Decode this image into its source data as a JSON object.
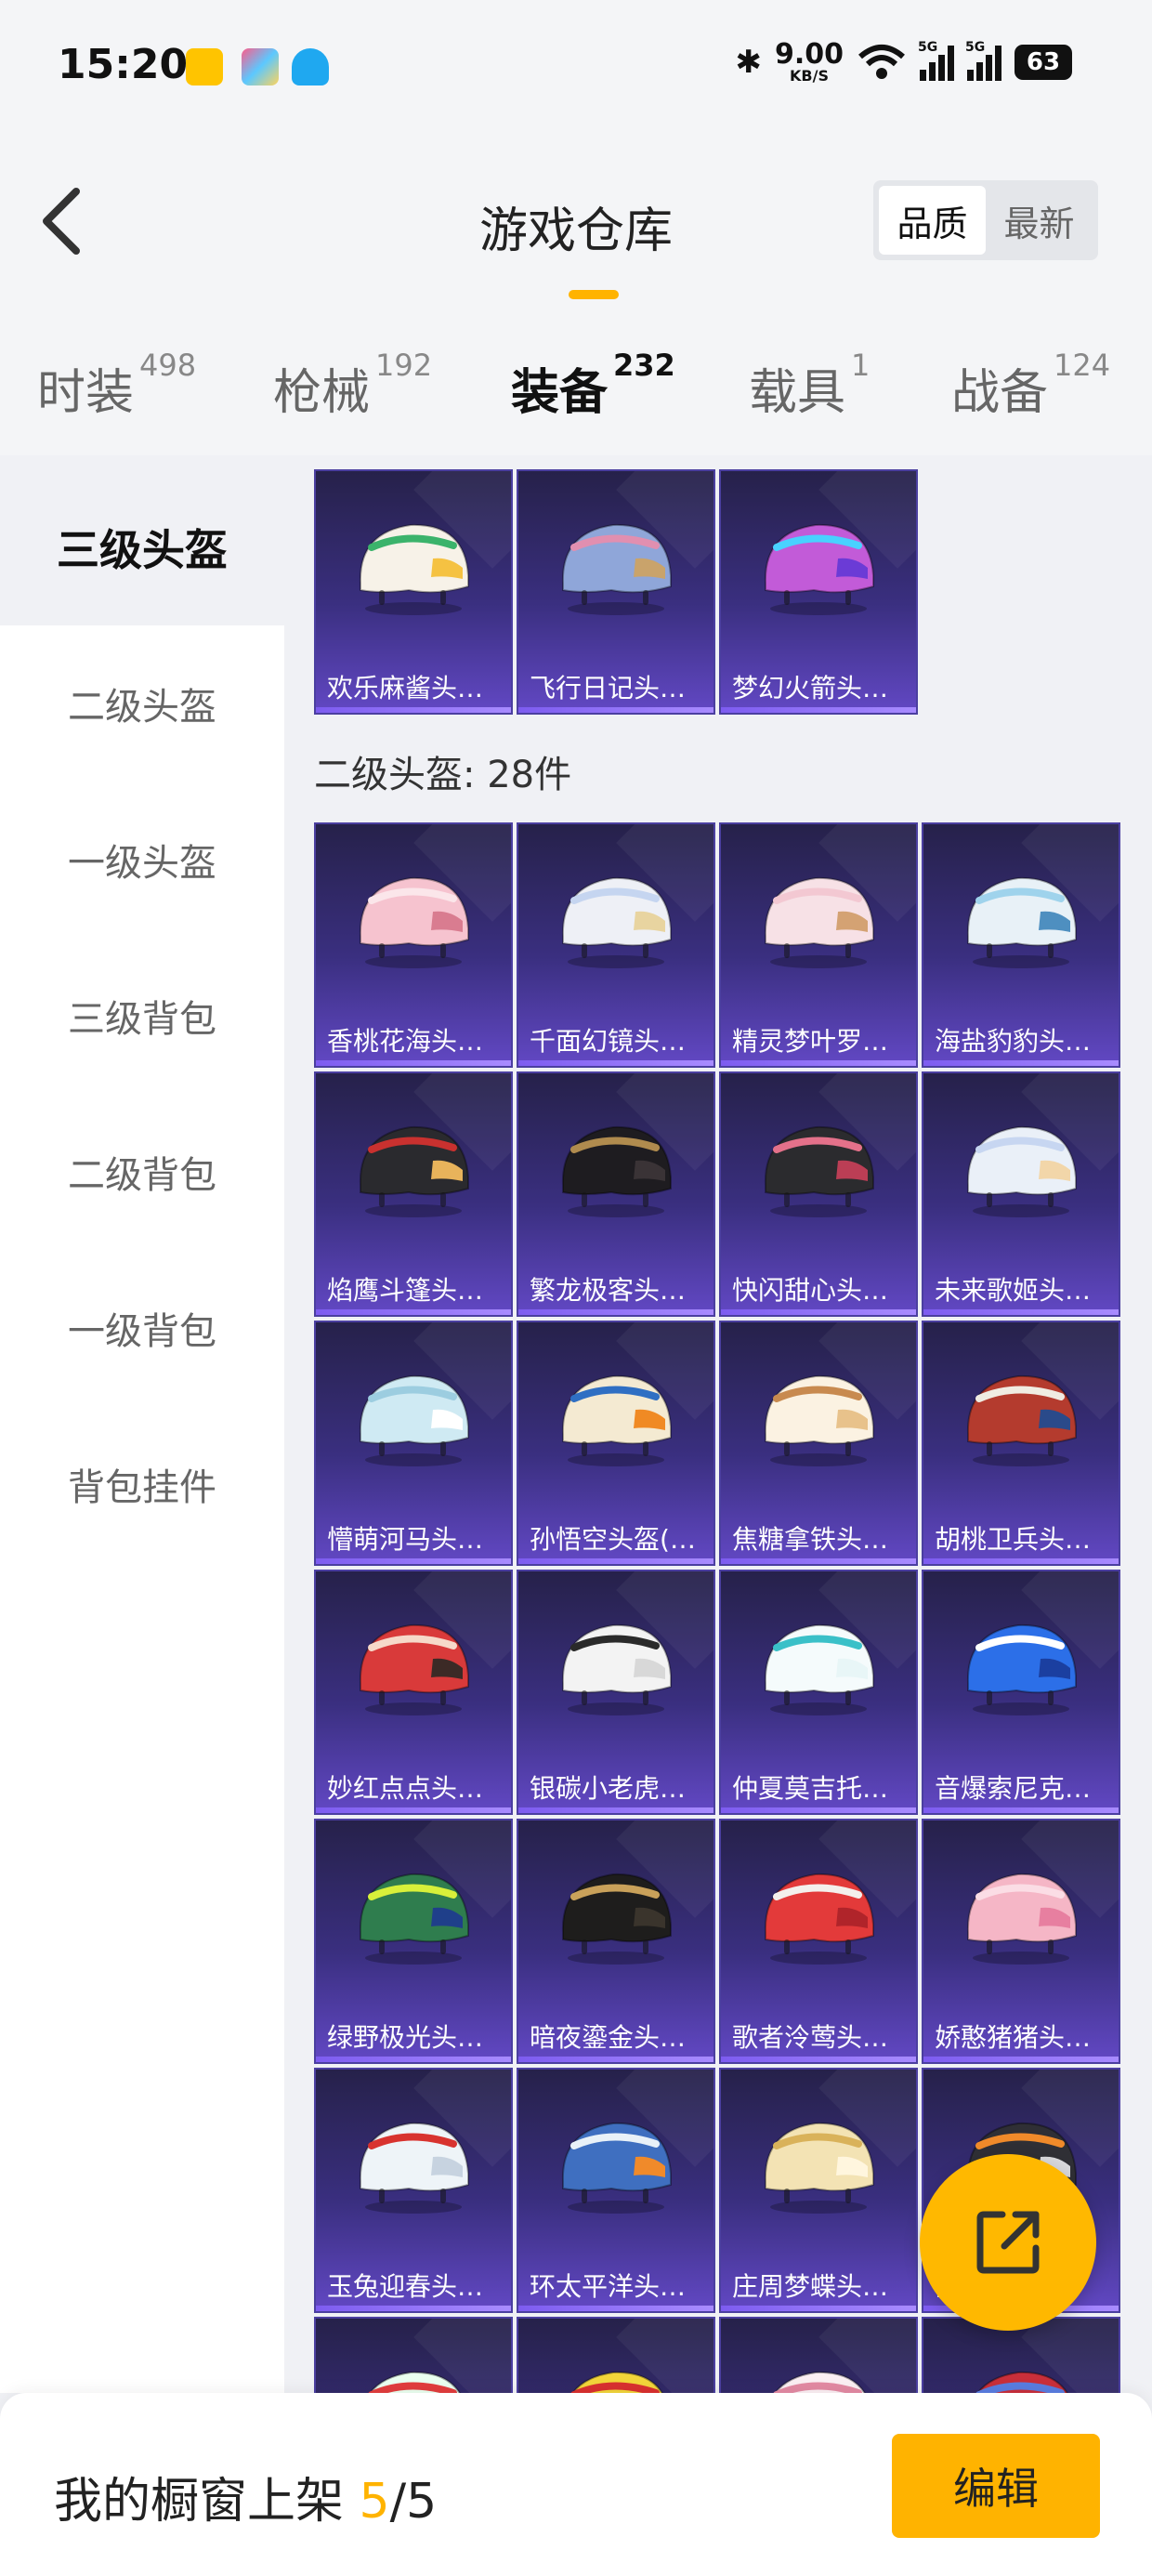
{
  "status_bar": {
    "time": "15:20",
    "net_speed": "9.00",
    "net_unit": "KB/S",
    "sim1": "5G",
    "sim2": "5G",
    "battery": "63"
  },
  "header": {
    "title": "游戏仓库",
    "sort_options": [
      "品质",
      "最新"
    ],
    "sort_selected": "品质"
  },
  "tabs": [
    {
      "label": "时装",
      "count": "498"
    },
    {
      "label": "枪械",
      "count": "192"
    },
    {
      "label": "装备",
      "count": "232",
      "active": true
    },
    {
      "label": "载具",
      "count": "1"
    },
    {
      "label": "战备",
      "count": "124"
    }
  ],
  "sidebar": {
    "items": [
      {
        "label": "三级头盔",
        "active": true
      },
      {
        "label": "二级头盔"
      },
      {
        "label": "一级头盔"
      },
      {
        "label": "三级背包"
      },
      {
        "label": "二级背包"
      },
      {
        "label": "一级背包"
      },
      {
        "label": "背包挂件"
      }
    ]
  },
  "sections": [
    {
      "label": "",
      "items": [
        "欢乐麻酱头盔...",
        "飞行日记头盔...",
        "梦幻火箭头盔..."
      ]
    },
    {
      "label": "二级头盔: 28件",
      "items": [
        "香桃花海头盔...",
        "千面幻镜头盔...",
        "精灵梦叶罗丽...",
        "海盐豹豹头盔...",
        "焰鹰斗篷头盔...",
        "繁龙极客头盔...",
        "快闪甜心头盔...",
        "未来歌姬头盔...",
        "懵萌河马头盔...",
        "孙悟空头盔(2...",
        "焦糖拿铁头盔...",
        "胡桃卫兵头盔...",
        "妙红点点头盔...",
        "银碳小老虎头...",
        "仲夏莫吉托头...",
        "音爆索尼克头...",
        "绿野极光头盔...",
        "暗夜鎏金头盔...",
        "歌者泠莺头盔...",
        "娇憨猪猪头盔...",
        "玉兔迎春头盔...",
        "环太平洋头盔...",
        "庄周梦蝶头盔...",
        "...",
        "",
        "",
        "",
        ""
      ]
    }
  ],
  "bottom_bar": {
    "prefix": "我的橱窗上架",
    "current": "5",
    "total": "/5",
    "edit_label": "编辑"
  },
  "colors": {
    "accent": "#ffb300",
    "card_top": "#26214a",
    "card_bottom": "#6248c4"
  }
}
